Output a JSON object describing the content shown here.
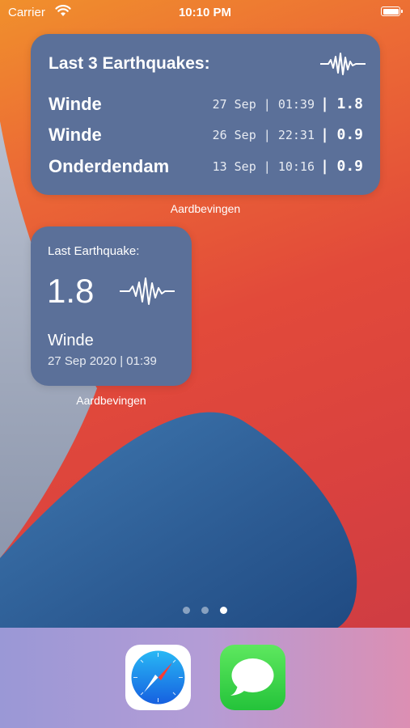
{
  "status_bar": {
    "carrier": "Carrier",
    "time": "10:10 PM",
    "icons": [
      "wifi-icon",
      "battery-icon"
    ]
  },
  "widget_large": {
    "title": "Last 3 Earthquakes:",
    "icon": "seismograph-icon",
    "quakes": [
      {
        "location": "Winde",
        "date": "27 Sep",
        "time": "01:39",
        "magnitude": "1.8"
      },
      {
        "location": "Winde",
        "date": "26 Sep",
        "time": "22:31",
        "magnitude": "0.9"
      },
      {
        "location": "Onderdendam",
        "date": "13 Sep",
        "time": "10:16",
        "magnitude": "0.9"
      }
    ],
    "label": "Aardbevingen"
  },
  "widget_small": {
    "title": "Last Earthquake:",
    "magnitude": "1.8",
    "icon": "seismograph-icon",
    "location": "Winde",
    "datetime": "27 Sep 2020 | 01:39",
    "label": "Aardbevingen"
  },
  "page_indicator": {
    "pages": 3,
    "current": 3
  },
  "dock": {
    "apps": [
      {
        "name": "Safari",
        "icon": "safari-icon"
      },
      {
        "name": "Messages",
        "icon": "messages-icon"
      }
    ]
  },
  "colors": {
    "widget_bg": "#5b7099",
    "wallpaper_orange": "#ec6b35",
    "wallpaper_red": "#d9413f",
    "wallpaper_blue": "#2d5a90"
  }
}
